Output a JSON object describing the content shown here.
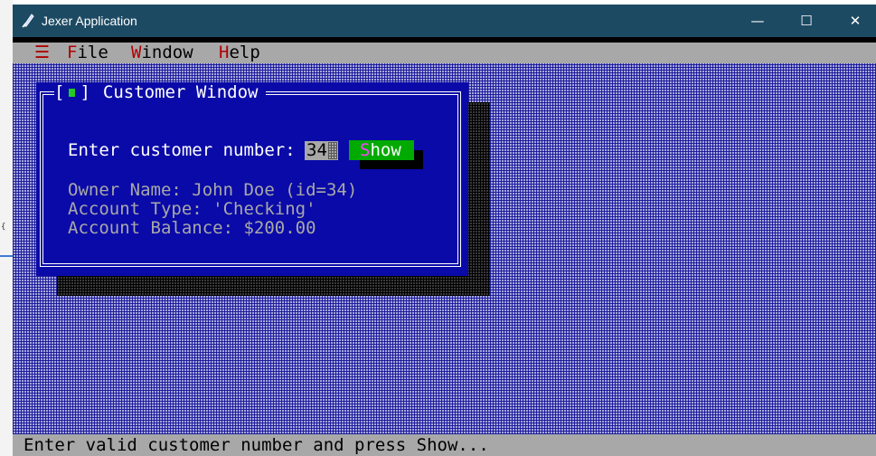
{
  "window": {
    "title": "Jexer Application",
    "icon": "feather-app-icon",
    "controls": {
      "minimize": "—",
      "maximize": "☐",
      "close": "✕"
    }
  },
  "menubar": {
    "system_glyph": "☰",
    "items": [
      {
        "hotkey": "F",
        "rest": "ile"
      },
      {
        "hotkey": "W",
        "rest": "indow"
      },
      {
        "hotkey": "H",
        "rest": "elp"
      }
    ]
  },
  "customer_window": {
    "title": "Customer Window",
    "close_left": "[",
    "close_right": "]",
    "prompt": "Enter customer number:",
    "customer_number": "34",
    "show_button": {
      "hotkey": "S",
      "rest": "how"
    },
    "owner_line": "Owner Name: John Doe (id=34)",
    "type_line": "Account Type: 'Checking'",
    "balance_line": "Account Balance: $200.00"
  },
  "statusbar": {
    "text": "Enter valid customer number and press Show..."
  },
  "colors": {
    "titlebar": "#1d4a63",
    "window_bg": "#0a0aa8",
    "button_bg": "#00aa00",
    "hotkey_menu": "#b00000",
    "hotkey_button": "#ff44ff"
  }
}
